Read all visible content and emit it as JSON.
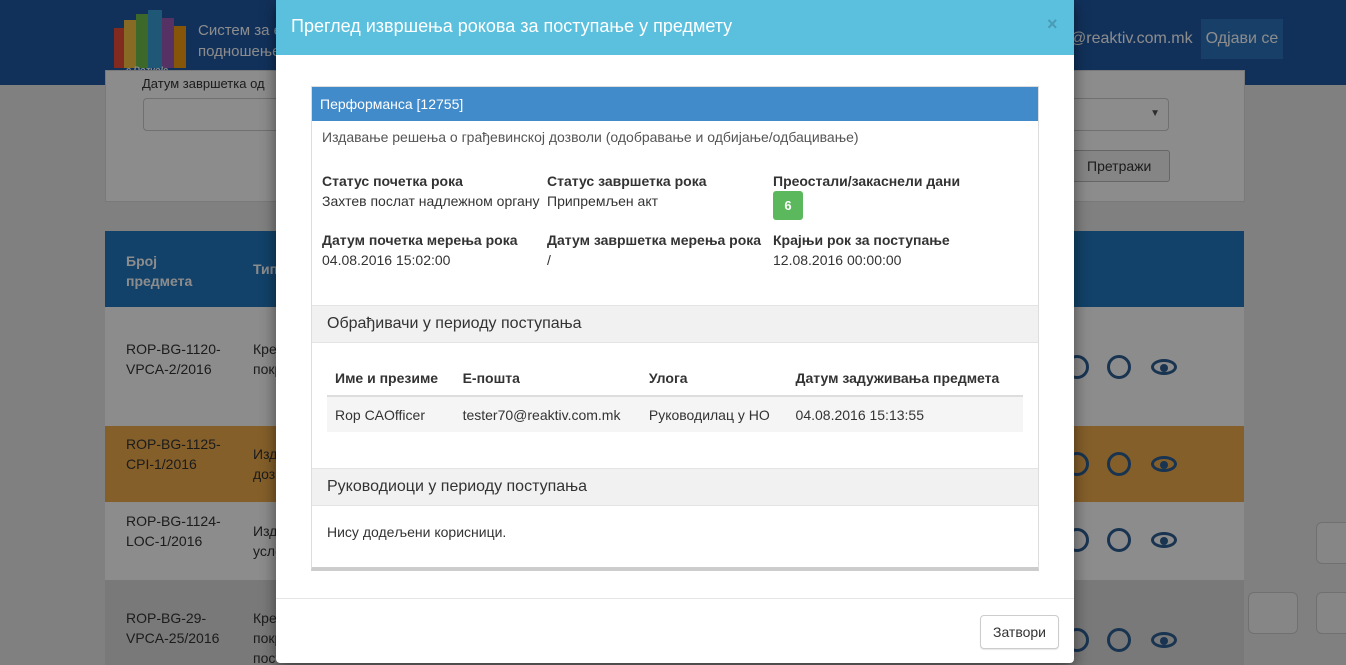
{
  "background": {
    "header": {
      "logo_text": "e Dozvole",
      "system_title_line1": "Систем за е",
      "system_title_line2": "подношење",
      "user_email": "@reaktiv.com.mk",
      "logout_label": "Одјави се"
    },
    "filter": {
      "date_label": "Датум завршетка од",
      "search_label": "Претражи"
    },
    "table": {
      "col_number": "Број предмета",
      "col_type": "Тип",
      "rows": [
        {
          "number": "ROP-BG-1120-VPCA-2/2016",
          "type": "Креирање покр",
          "highlight": "#ffffff"
        },
        {
          "number": "ROP-BG-1125-CPI-1/2016",
          "type": "Изд дозв",
          "highlight": "#f0ad4e"
        },
        {
          "number": "ROP-BG-1124-LOC-1/2016",
          "type": "Изд усло",
          "highlight": "#ffffff"
        },
        {
          "number": "ROP-BG-29-VPCA-25/2016",
          "type": "Креирање покр пост",
          "highlight": "#dcdcdc"
        }
      ]
    }
  },
  "modal": {
    "title": "Преглед извршења рокова за поступање у предмету",
    "close_icon": "×",
    "panel_header": "Перформанса [12755]",
    "description": "Издавање решења о грађевинској дозволи (одобравање и одбијање/одбацивање)",
    "fields": {
      "start_status_label": "Статус почетка рока",
      "start_status_value": "Захтев послат надлежном органу",
      "end_status_label": "Статус завршетка рока",
      "end_status_value": "Припремљен акт",
      "remaining_label": "Преостали/закаснели дани",
      "remaining_value": "6",
      "start_date_label": "Датум почетка мерења рока",
      "start_date_value": "04.08.2016 15:02:00",
      "end_date_label": "Датум завршетка мерења рока",
      "end_date_value": "/",
      "deadline_label": "Крајњи рок за поступање",
      "deadline_value": "12.08.2016 00:00:00"
    },
    "processors_section": {
      "title": "Обрађивачи у периоду поступања",
      "columns": [
        "Име и презиме",
        "Е-пошта",
        "Улога",
        "Датум задуживања предмета"
      ],
      "rows": [
        [
          "Rop CAOfficer",
          "tester70@reaktiv.com.mk",
          "Руководилац у НО",
          "04.08.2016 15:13:55"
        ]
      ]
    },
    "managers_section": {
      "title": "Руководиоци у периоду поступања",
      "empty_text": "Нису додељени корисници."
    },
    "close_button": "Затвори"
  },
  "colors": {
    "header_bg": "#1f5aa6",
    "modal_header": "#5bc0de",
    "panel_header": "#428bca",
    "badge_success": "#5cb85c"
  }
}
